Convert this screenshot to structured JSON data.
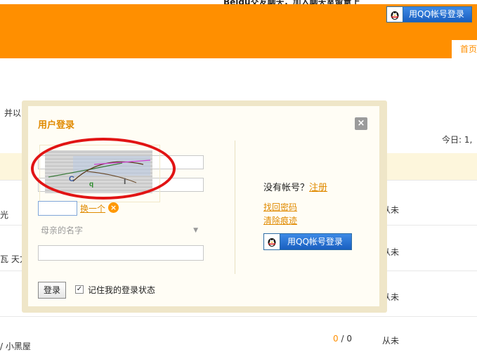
{
  "top_banner": "Beidu交友聊天，加入聊天室留意上",
  "header": {
    "qq_login_label": "用QQ帐号登录",
    "home_tab": "首页"
  },
  "background": {
    "left_text_1": "并以",
    "today_count": "今日: 1,",
    "row_labels": [
      "从未",
      "从未",
      "从未",
      "从未"
    ],
    "left_text_2": "光",
    "left_text_3": "瓦 天方",
    "left_text_4": "/ 小黑屋",
    "post_count_zero": "0",
    "post_count_rest": " / 0"
  },
  "modal": {
    "title": "用户登录",
    "close_label": "×",
    "change_captcha_label": "换一个",
    "security_question_placeholder": "母亲的名字",
    "login_button": "登录",
    "remember_label": "记住我的登录状态",
    "no_account_text": "没有帐号？",
    "register_link": "注册",
    "find_password_link": "找回密码",
    "clear_traces_link": "清除痕迹",
    "qq_login_label": "用QQ帐号登录"
  }
}
